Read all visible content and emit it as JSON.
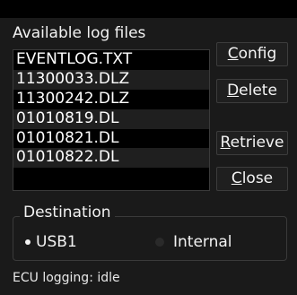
{
  "dialog": {
    "title": "Available log files"
  },
  "files": [
    "EVENTLOG.TXT",
    "11300033.DLZ",
    "11300242.DLZ",
    "01010819.DL",
    "01010821.DL",
    "01010822.DL"
  ],
  "buttons": {
    "config": {
      "accel": "C",
      "rest": "onfig"
    },
    "delete": {
      "accel": "D",
      "rest": "elete"
    },
    "retrieve": {
      "accel": "R",
      "rest": "etrieve"
    },
    "close": {
      "accel": "C",
      "rest": "lose"
    }
  },
  "destination": {
    "label": "Destination",
    "options": [
      "USB1",
      "Internal"
    ],
    "selected": "USB1"
  },
  "status": "ECU logging: idle",
  "colors": {
    "background": "#1a1a1a",
    "list_background": "#000000",
    "text": "#f2f2f2"
  }
}
